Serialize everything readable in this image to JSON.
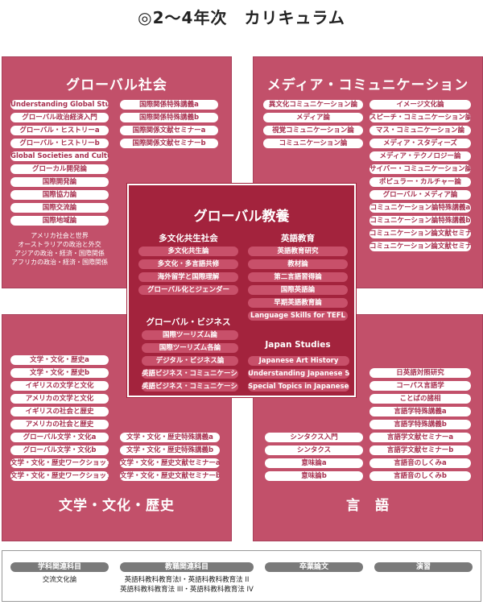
{
  "title": "◎2～4年次　カリキュラム",
  "global_society": {
    "title": "グローバル社会",
    "left_items": [
      "Understanding Global Studies",
      "グローバル政治経済入門",
      "グローバル・ヒストリーa",
      "グローバル・ヒストリーb",
      "Global Societies and Cultures",
      "グローカル開発論",
      "国際開発論",
      "国際協力論",
      "国際交流論",
      "国際地域論"
    ],
    "right_items": [
      "国際関係特殊講義a",
      "国際関係特殊講義b",
      "国際関係文献セミナーa",
      "国際関係文献セミナーb"
    ],
    "notes": [
      "アメリカ社会と世界",
      "オーストラリアの政治と外交",
      "アジアの政治・経済・国際関係",
      "アフリカの政治・経済・国際関係"
    ]
  },
  "media": {
    "title": "メディア・コミュニケーション",
    "left_items": [
      "異文化コミュニケーション論",
      "メディア論",
      "視覚コミュニケーション論",
      "コミュニケーション論"
    ],
    "right_items": [
      "イメージ文化論",
      "スピーチ・コミュニケーション論",
      "マス・コミュニケーション論",
      "メディア・スタディーズ",
      "メディア・テクノロジー論",
      "サイバー・コミュニケーション論",
      "ポピュラー・カルチャー論",
      "グローバル・メディア論",
      "コミュニケーション論特殊講義a",
      "コミュニケーション論特殊講義b",
      "コミュニケーション論文献セミナーa",
      "コミュニケーション論文献セミナーb"
    ]
  },
  "literature": {
    "title": "文学・文化・歴史",
    "left_items": [
      "文学・文化・歴史a",
      "文学・文化・歴史b",
      "イギリスの文学と文化",
      "アメリカの文学と文化",
      "イギリスの社会と歴史",
      "アメリカの社会と歴史",
      "グローバル文学・文化a",
      "グローバル文学・文化b",
      "文学・文化・歴史ワークショップa",
      "文学・文化・歴史ワークショップb"
    ],
    "right_items": [
      "文学・文化・歴史特殊講義a",
      "文学・文化・歴史特殊講義b",
      "文学・文化・歴史文献セミナーa",
      "文学・文化・歴史文献セミナーb"
    ]
  },
  "language": {
    "title": "言　語",
    "left_items": [
      "シンタクス入門",
      "シンタクス",
      "意味論a",
      "意味論b"
    ],
    "right_items": [
      "日英語対照研究",
      "コーパス言語学",
      "ことばの諸相",
      "言語学特殊講義a",
      "言語学特殊講義b",
      "言語学文献セミナーa",
      "言語学文献セミナーb",
      "言語音のしくみa",
      "言語音のしくみb"
    ]
  },
  "center": {
    "title": "グローバル教養",
    "multicultural": {
      "heading": "多文化共生社会",
      "items": [
        "多文化共生論",
        "多文化・多言語共修",
        "海外留学と国際理解",
        "グローバル化とジェンダー"
      ]
    },
    "english_edu": {
      "heading": "英語教育",
      "items": [
        "英語教育研究",
        "教材論",
        "第二言語習得論",
        "国際英語論",
        "早期英語教育論",
        "Language Skills for TEFL"
      ]
    },
    "business": {
      "heading": "グローバル・ビジネス",
      "items": [
        "国際ツーリズム論",
        "国際ツーリズム各論",
        "デジタル・ビジネス論",
        "英語ビジネス・コミュニケーション",
        "英語ビジネス・コミュニケーション実務"
      ]
    },
    "japan": {
      "heading": "Japan Studies",
      "items": [
        "Japanese Art History",
        "Understanding Japanese Society",
        "Special Topics in Japanese Studies"
      ]
    }
  },
  "bottom": {
    "related_head": "学科関連科目",
    "related_text": "交流文化論",
    "teaching_head": "教職関連科目",
    "teaching_line1": "英語科教科教育法Ⅰ・英語科教科教育法 II",
    "teaching_line2": "英語科教科教育法 III・英語科教科教育法 IV",
    "thesis_head": "卒業論文",
    "seminar_head": "演習"
  },
  "colors": {
    "quadrant": "#c2506a",
    "center": "#a3233d",
    "pill_text": "#a8304f",
    "bottom_head": "#7a7a7a"
  }
}
